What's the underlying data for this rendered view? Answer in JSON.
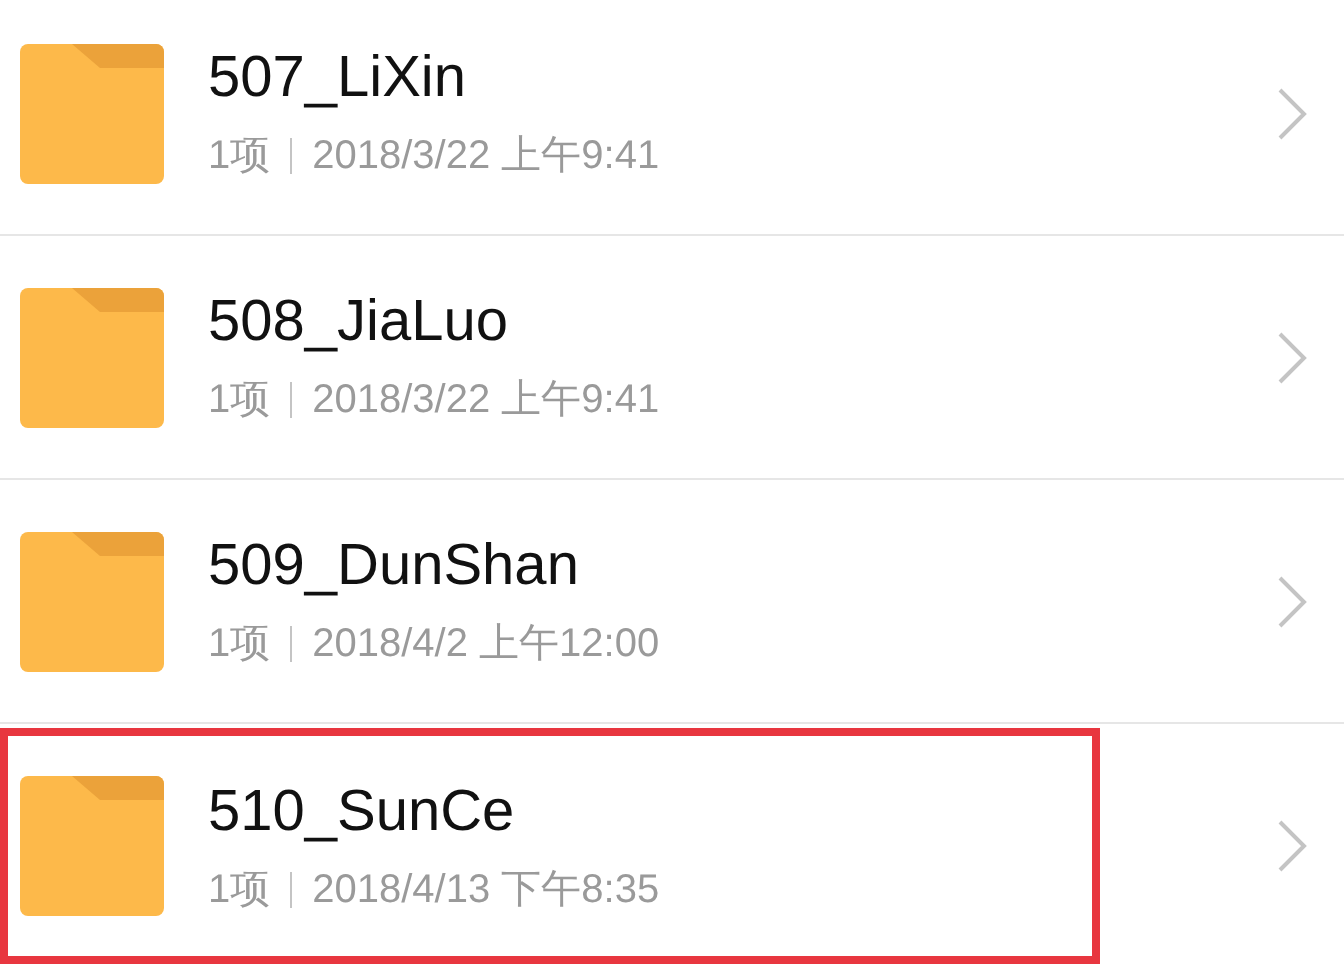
{
  "items": [
    {
      "name": "507_LiXin",
      "count": "1项",
      "date": "2018/3/22 上午9:41",
      "highlighted": false
    },
    {
      "name": "508_JiaLuo",
      "count": "1项",
      "date": "2018/3/22 上午9:41",
      "highlighted": false
    },
    {
      "name": "509_DunShan",
      "count": "1项",
      "date": "2018/4/2 上午12:00",
      "highlighted": false
    },
    {
      "name": "510_SunCe",
      "count": "1项",
      "date": "2018/4/13 下午8:35",
      "highlighted": true
    }
  ]
}
